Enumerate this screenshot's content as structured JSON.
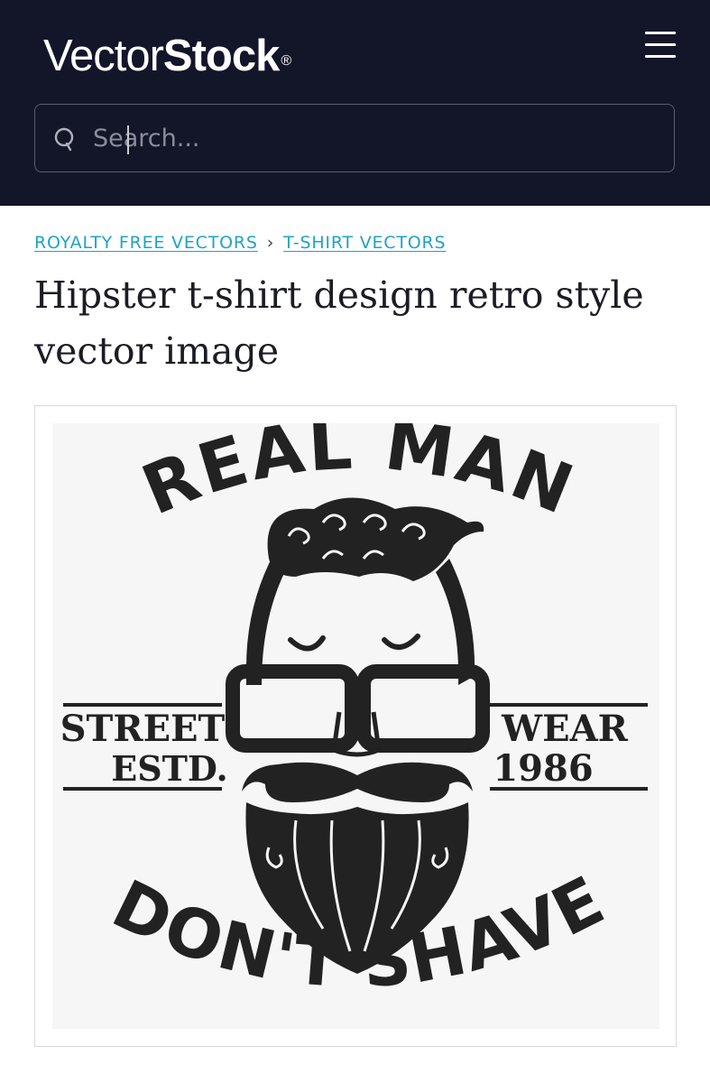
{
  "header": {
    "logo": {
      "part1": "Vector",
      "part2": "Stock",
      "reg": "®"
    },
    "menu_icon": "hamburger-menu-icon",
    "bg_color": "#131629"
  },
  "search": {
    "placeholder": "Search...",
    "value": "",
    "icon": "search-icon"
  },
  "breadcrumb": {
    "items": [
      "ROYALTY FREE VECTORS",
      "T-SHIRT VECTORS"
    ],
    "separator": "›",
    "link_color": "#1fa3c4"
  },
  "page": {
    "title": "Hipster t-shirt design retro style vector image"
  },
  "artwork": {
    "top_text": "REAL MAN",
    "bottom_text": "DON'T SHAVE",
    "left_line1": "STREET",
    "left_line2": "ESTD.",
    "right_line1": "WEAR",
    "right_line2": "1986",
    "ink_color": "#222222",
    "bg_color": "#f6f6f6"
  }
}
